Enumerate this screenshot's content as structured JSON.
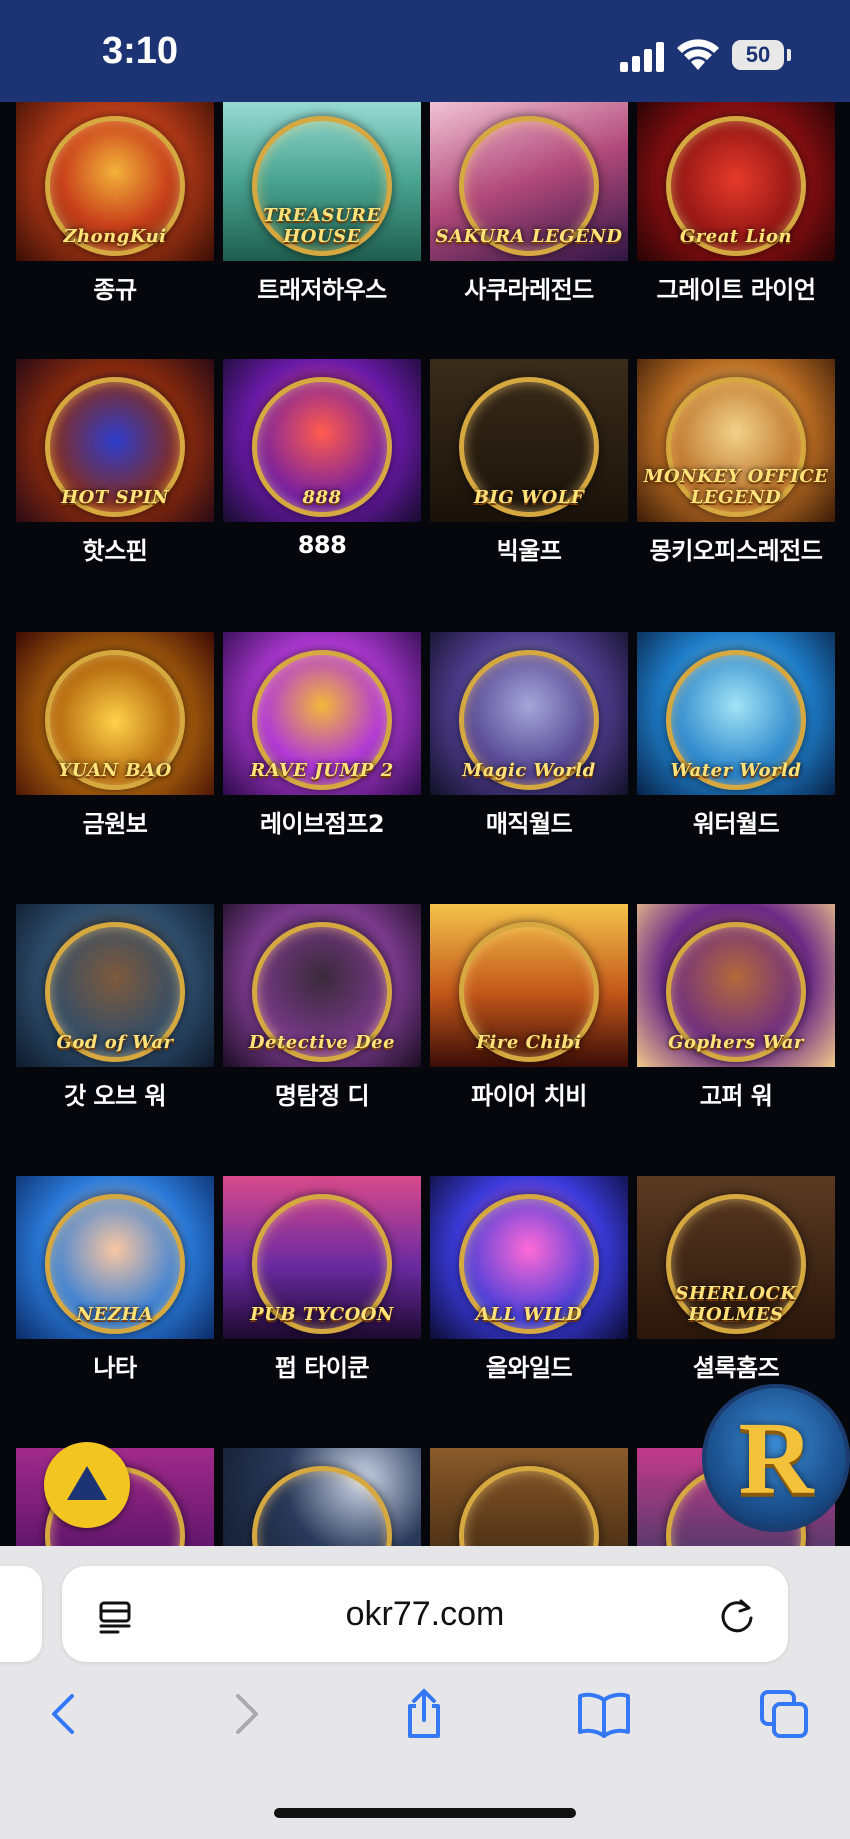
{
  "status_bar": {
    "time": "3:10",
    "battery": "50",
    "icons": [
      "signal-icon",
      "wifi-icon",
      "battery-icon"
    ]
  },
  "games": [
    {
      "title": "종규",
      "logo": "ZhongKui",
      "bg": "zhongkui"
    },
    {
      "title": "트래저하우스",
      "logo": "TREASURE HOUSE",
      "bg": "treasure"
    },
    {
      "title": "사쿠라레전드",
      "logo": "SAKURA LEGEND",
      "bg": "sakura"
    },
    {
      "title": "그레이트 라이언",
      "logo": "Great Lion",
      "bg": "greatlion"
    },
    {
      "title": "핫스핀",
      "logo": "HOT SPIN",
      "bg": "hotspin"
    },
    {
      "title": "888",
      "logo": "888",
      "bg": "888"
    },
    {
      "title": "빅울프",
      "logo": "BIG WOLF",
      "bg": "bigwolf"
    },
    {
      "title": "몽키오피스레전드",
      "logo": "MONKEY OFFICE LEGEND",
      "bg": "monkey"
    },
    {
      "title": "금원보",
      "logo": "YUAN BAO",
      "bg": "yuanbao"
    },
    {
      "title": "레이브점프2",
      "logo": "RAVE JUMP 2",
      "bg": "rave"
    },
    {
      "title": "매직월드",
      "logo": "Magic World",
      "bg": "magic"
    },
    {
      "title": "워터월드",
      "logo": "Water World",
      "bg": "water"
    },
    {
      "title": "갓 오브 워",
      "logo": "God of War",
      "bg": "godwar"
    },
    {
      "title": "명탐정 디",
      "logo": "Detective Dee",
      "bg": "dee"
    },
    {
      "title": "파이어 치비",
      "logo": "Fire Chibi",
      "bg": "firechibi"
    },
    {
      "title": "고퍼 워",
      "logo": "Gophers War",
      "bg": "gophers"
    },
    {
      "title": "나타",
      "logo": "NEZHA",
      "bg": "nata"
    },
    {
      "title": "펍 타이쿤",
      "logo": "PUB TYCOON",
      "bg": "pub"
    },
    {
      "title": "올와일드",
      "logo": "ALL WILD",
      "bg": "allwild"
    },
    {
      "title": "셜록홈즈",
      "logo": "SHERLOCK HOLMES",
      "bg": "sherlock"
    },
    {
      "title": "",
      "logo": "",
      "bg": "r6a"
    },
    {
      "title": "",
      "logo": "",
      "bg": "r6b"
    },
    {
      "title": "",
      "logo": "",
      "bg": "r6c"
    },
    {
      "title": "",
      "logo": "",
      "bg": "r6d"
    }
  ],
  "floating": {
    "scroll_top_icon": "up-triangle-icon",
    "brand_badge": "R"
  },
  "browser": {
    "url": "okr77.com",
    "icons": [
      "reader-icon",
      "reload-icon",
      "back-icon",
      "forward-icon",
      "share-icon",
      "bookmarks-icon",
      "tabs-icon"
    ],
    "accent": "#3478f6",
    "disabled": "#a9a9ae"
  },
  "colors": {
    "status_bar": "#1c3473",
    "page_bg": "#06070c",
    "scroll_button": "#f3c521"
  }
}
